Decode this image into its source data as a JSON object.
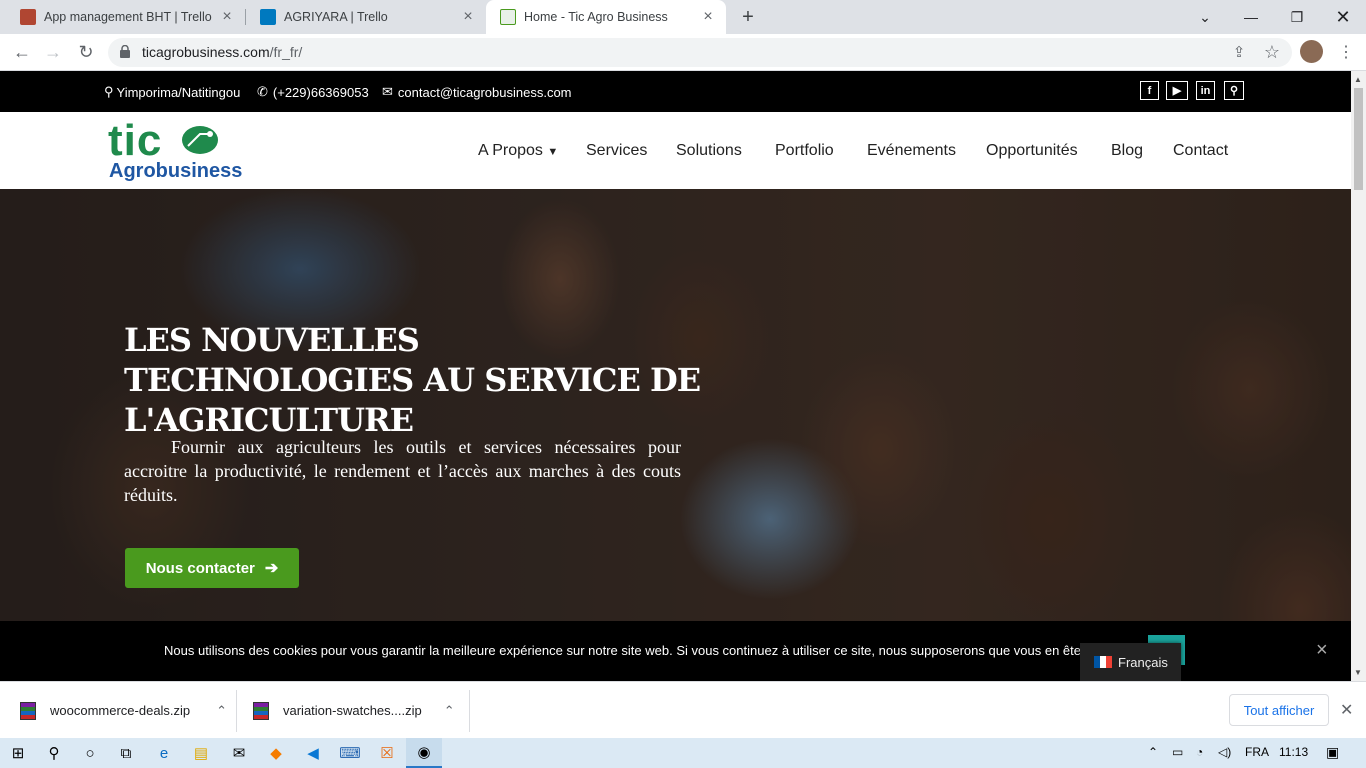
{
  "browser": {
    "tabs": [
      {
        "title": "App management BHT | Trello",
        "active": false
      },
      {
        "title": "AGRIYARA | Trello",
        "active": false
      },
      {
        "title": "Home - Tic Agro Business",
        "active": true
      }
    ],
    "url_domain": "ticagrobusiness.com",
    "url_path": "/fr_fr/"
  },
  "topbar": {
    "location": "Yimporima/Natitingou",
    "phone": "(+229)66369053",
    "email": "contact@ticagrobusiness.com",
    "social_icons": [
      "facebook-icon",
      "youtube-icon",
      "linkedin-icon",
      "search-icon"
    ]
  },
  "logo": {
    "main": "tic",
    "sub": "Agrobusiness"
  },
  "menu": {
    "items": [
      "A Propos",
      "Services",
      "Solutions",
      "Portfolio",
      "Evénements",
      "Opportunités",
      "Blog",
      "Contact"
    ]
  },
  "hero": {
    "title": "LES NOUVELLES TECHNOLOGIES AU SERVICE DE L'AGRICULTURE",
    "text": "Fournir aux agriculteurs les outils et services nécessaires pour accroitre la productivité, le rendement et l’accès aux marches à des couts réduits.",
    "cta": "Nous contacter"
  },
  "cookie": {
    "message": "Nous utilisons des cookies pour vous garantir la meilleure expérience sur notre site web. Si vous continuez à utiliser ce site, nous supposerons que vous en ête",
    "close": "×"
  },
  "language": {
    "label": "Français"
  },
  "downloads": {
    "items": [
      "woocommerce-deals.zip",
      "variation-swatches....zip"
    ],
    "show_all": "Tout afficher"
  },
  "taskbar": {
    "lang": "FRA",
    "time": "11:13"
  },
  "colors": {
    "accent_green": "#4a9a1e",
    "logo_green": "#1f8a4c",
    "logo_blue": "#1f57a3",
    "cookie_ok": "#1aa39c"
  }
}
